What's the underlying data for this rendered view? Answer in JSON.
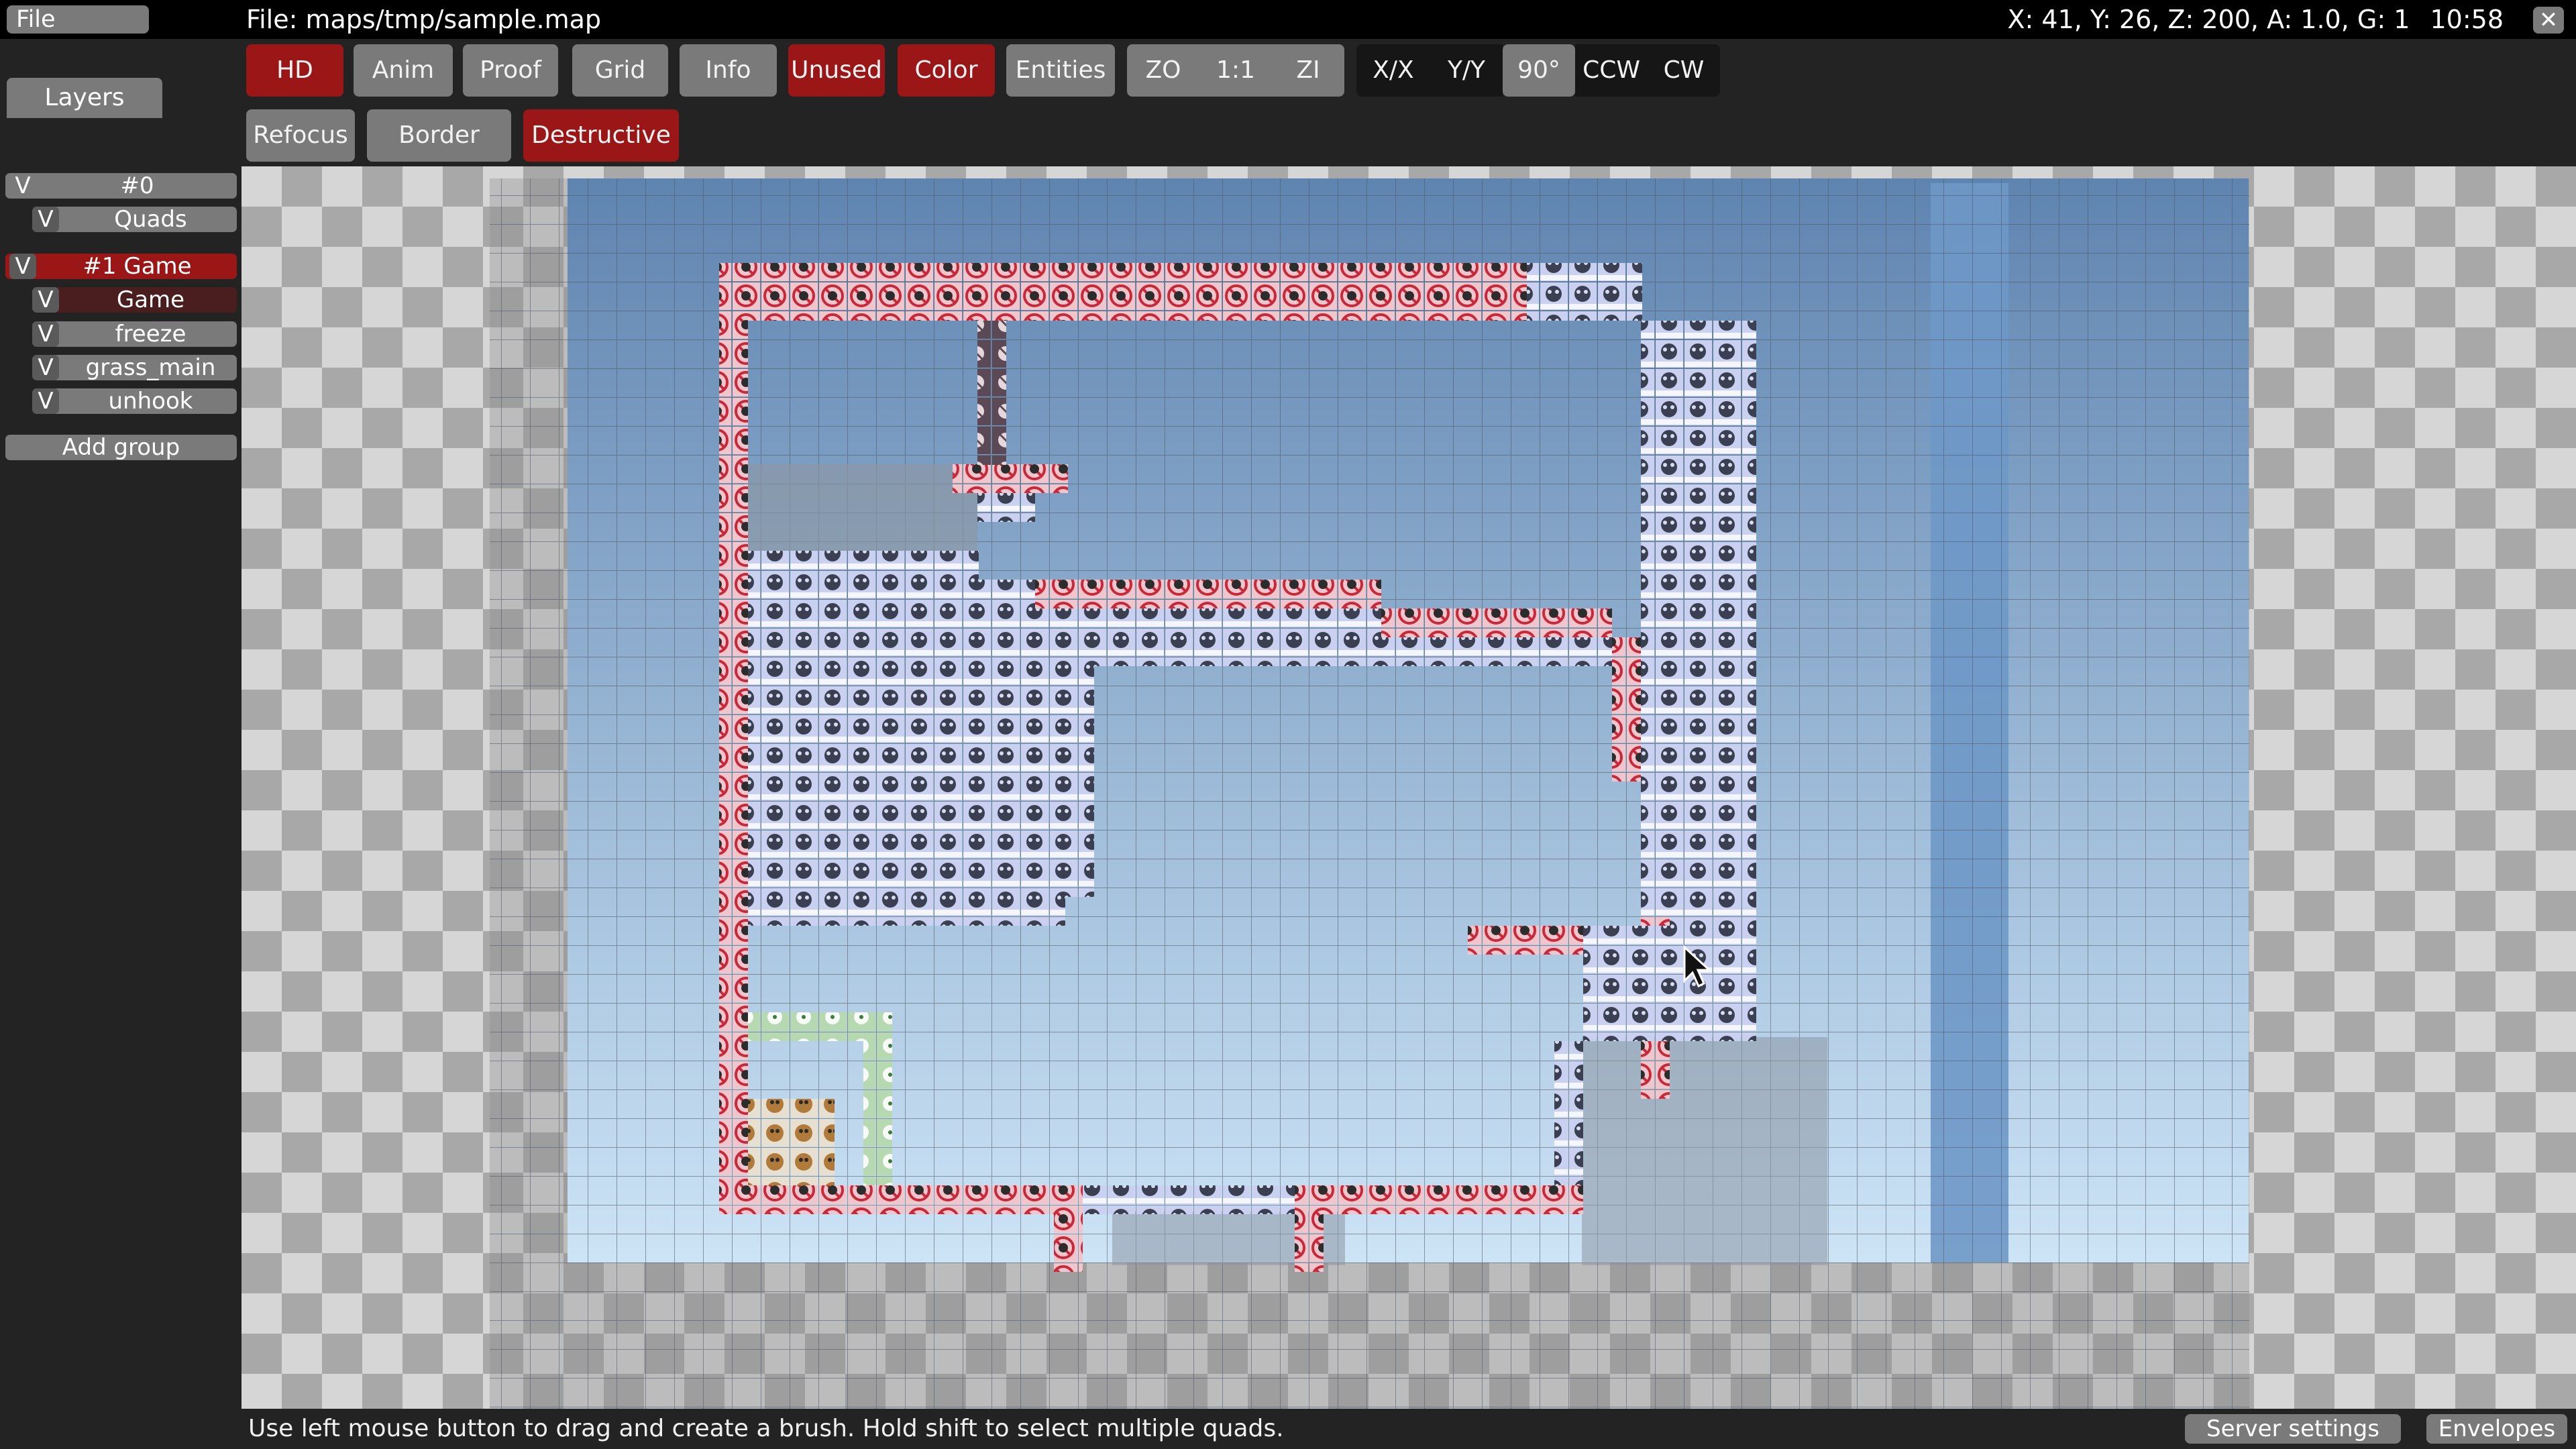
{
  "menu": {
    "file": "File"
  },
  "title": "File: maps/tmp/sample.map",
  "status": {
    "readout": "X: 41, Y: 26, Z: 200, A: 1.0, G: 1",
    "clock": "10:58",
    "close": "✕"
  },
  "toolbar": {
    "hd": "HD",
    "anim": "Anim",
    "proof": "Proof",
    "grid": "Grid",
    "info": "Info",
    "unused": "Unused",
    "color": "Color",
    "entities": "Entities",
    "zo": "ZO",
    "one_to_one": "1:1",
    "zi": "ZI",
    "flip_x": "X/X",
    "flip_y": "Y/Y",
    "rot90": "90°",
    "ccw": "CCW",
    "cw": "CW",
    "refocus": "Refocus",
    "border": "Border",
    "destructive": "Destructive"
  },
  "sidebar": {
    "tab": "Layers",
    "groups": [
      {
        "v": "V",
        "label": "#0",
        "layers": [
          {
            "v": "V",
            "label": "Quads"
          }
        ]
      },
      {
        "v": "V",
        "label": "#1 Game",
        "layers": [
          {
            "v": "V",
            "label": "Game"
          },
          {
            "v": "V",
            "label": "freeze"
          },
          {
            "v": "V",
            "label": "grass_main"
          },
          {
            "v": "V",
            "label": "unhook"
          }
        ]
      }
    ],
    "add_group": "Add group"
  },
  "footer": {
    "hint": "Use left mouse button to drag and create a brush. Hold shift to select multiple quads.",
    "server_settings": "Server settings",
    "envelopes": "Envelopes"
  },
  "colors": {
    "active": "#9b1717",
    "button": "#7a7a7a",
    "sky_top": "#5f84b0",
    "sky_bottom": "#cde4f6",
    "freeze_tile": "#c9d0f0",
    "death_tile": "#f0c6cc",
    "unhook_tile": "#e2d3d6",
    "grass_tile": "#b6d9b2"
  },
  "icons": [
    "close-icon",
    "mouse-cursor-icon",
    "freeze-tile-icon",
    "death-tile-icon",
    "unhook-tile-icon",
    "spawn-tile-icon"
  ]
}
